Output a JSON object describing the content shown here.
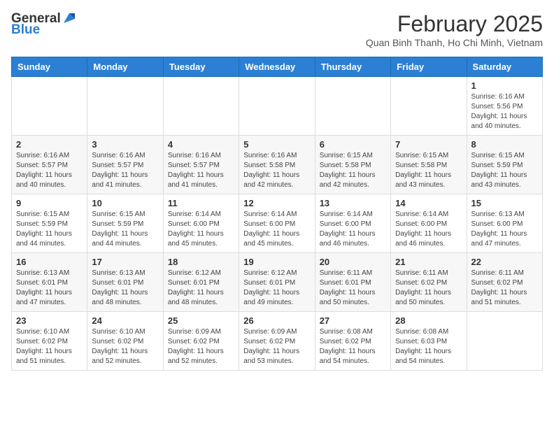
{
  "header": {
    "logo_general": "General",
    "logo_blue": "Blue",
    "month_year": "February 2025",
    "location": "Quan Binh Thanh, Ho Chi Minh, Vietnam"
  },
  "days_of_week": [
    "Sunday",
    "Monday",
    "Tuesday",
    "Wednesday",
    "Thursday",
    "Friday",
    "Saturday"
  ],
  "weeks": [
    [
      {
        "day": "",
        "info": ""
      },
      {
        "day": "",
        "info": ""
      },
      {
        "day": "",
        "info": ""
      },
      {
        "day": "",
        "info": ""
      },
      {
        "day": "",
        "info": ""
      },
      {
        "day": "",
        "info": ""
      },
      {
        "day": "1",
        "info": "Sunrise: 6:16 AM\nSunset: 5:56 PM\nDaylight: 11 hours\nand 40 minutes."
      }
    ],
    [
      {
        "day": "2",
        "info": "Sunrise: 6:16 AM\nSunset: 5:57 PM\nDaylight: 11 hours\nand 40 minutes."
      },
      {
        "day": "3",
        "info": "Sunrise: 6:16 AM\nSunset: 5:57 PM\nDaylight: 11 hours\nand 41 minutes."
      },
      {
        "day": "4",
        "info": "Sunrise: 6:16 AM\nSunset: 5:57 PM\nDaylight: 11 hours\nand 41 minutes."
      },
      {
        "day": "5",
        "info": "Sunrise: 6:16 AM\nSunset: 5:58 PM\nDaylight: 11 hours\nand 42 minutes."
      },
      {
        "day": "6",
        "info": "Sunrise: 6:15 AM\nSunset: 5:58 PM\nDaylight: 11 hours\nand 42 minutes."
      },
      {
        "day": "7",
        "info": "Sunrise: 6:15 AM\nSunset: 5:58 PM\nDaylight: 11 hours\nand 43 minutes."
      },
      {
        "day": "8",
        "info": "Sunrise: 6:15 AM\nSunset: 5:59 PM\nDaylight: 11 hours\nand 43 minutes."
      }
    ],
    [
      {
        "day": "9",
        "info": "Sunrise: 6:15 AM\nSunset: 5:59 PM\nDaylight: 11 hours\nand 44 minutes."
      },
      {
        "day": "10",
        "info": "Sunrise: 6:15 AM\nSunset: 5:59 PM\nDaylight: 11 hours\nand 44 minutes."
      },
      {
        "day": "11",
        "info": "Sunrise: 6:14 AM\nSunset: 6:00 PM\nDaylight: 11 hours\nand 45 minutes."
      },
      {
        "day": "12",
        "info": "Sunrise: 6:14 AM\nSunset: 6:00 PM\nDaylight: 11 hours\nand 45 minutes."
      },
      {
        "day": "13",
        "info": "Sunrise: 6:14 AM\nSunset: 6:00 PM\nDaylight: 11 hours\nand 46 minutes."
      },
      {
        "day": "14",
        "info": "Sunrise: 6:14 AM\nSunset: 6:00 PM\nDaylight: 11 hours\nand 46 minutes."
      },
      {
        "day": "15",
        "info": "Sunrise: 6:13 AM\nSunset: 6:00 PM\nDaylight: 11 hours\nand 47 minutes."
      }
    ],
    [
      {
        "day": "16",
        "info": "Sunrise: 6:13 AM\nSunset: 6:01 PM\nDaylight: 11 hours\nand 47 minutes."
      },
      {
        "day": "17",
        "info": "Sunrise: 6:13 AM\nSunset: 6:01 PM\nDaylight: 11 hours\nand 48 minutes."
      },
      {
        "day": "18",
        "info": "Sunrise: 6:12 AM\nSunset: 6:01 PM\nDaylight: 11 hours\nand 48 minutes."
      },
      {
        "day": "19",
        "info": "Sunrise: 6:12 AM\nSunset: 6:01 PM\nDaylight: 11 hours\nand 49 minutes."
      },
      {
        "day": "20",
        "info": "Sunrise: 6:11 AM\nSunset: 6:01 PM\nDaylight: 11 hours\nand 50 minutes."
      },
      {
        "day": "21",
        "info": "Sunrise: 6:11 AM\nSunset: 6:02 PM\nDaylight: 11 hours\nand 50 minutes."
      },
      {
        "day": "22",
        "info": "Sunrise: 6:11 AM\nSunset: 6:02 PM\nDaylight: 11 hours\nand 51 minutes."
      }
    ],
    [
      {
        "day": "23",
        "info": "Sunrise: 6:10 AM\nSunset: 6:02 PM\nDaylight: 11 hours\nand 51 minutes."
      },
      {
        "day": "24",
        "info": "Sunrise: 6:10 AM\nSunset: 6:02 PM\nDaylight: 11 hours\nand 52 minutes."
      },
      {
        "day": "25",
        "info": "Sunrise: 6:09 AM\nSunset: 6:02 PM\nDaylight: 11 hours\nand 52 minutes."
      },
      {
        "day": "26",
        "info": "Sunrise: 6:09 AM\nSunset: 6:02 PM\nDaylight: 11 hours\nand 53 minutes."
      },
      {
        "day": "27",
        "info": "Sunrise: 6:08 AM\nSunset: 6:02 PM\nDaylight: 11 hours\nand 54 minutes."
      },
      {
        "day": "28",
        "info": "Sunrise: 6:08 AM\nSunset: 6:03 PM\nDaylight: 11 hours\nand 54 minutes."
      },
      {
        "day": "",
        "info": ""
      }
    ]
  ]
}
